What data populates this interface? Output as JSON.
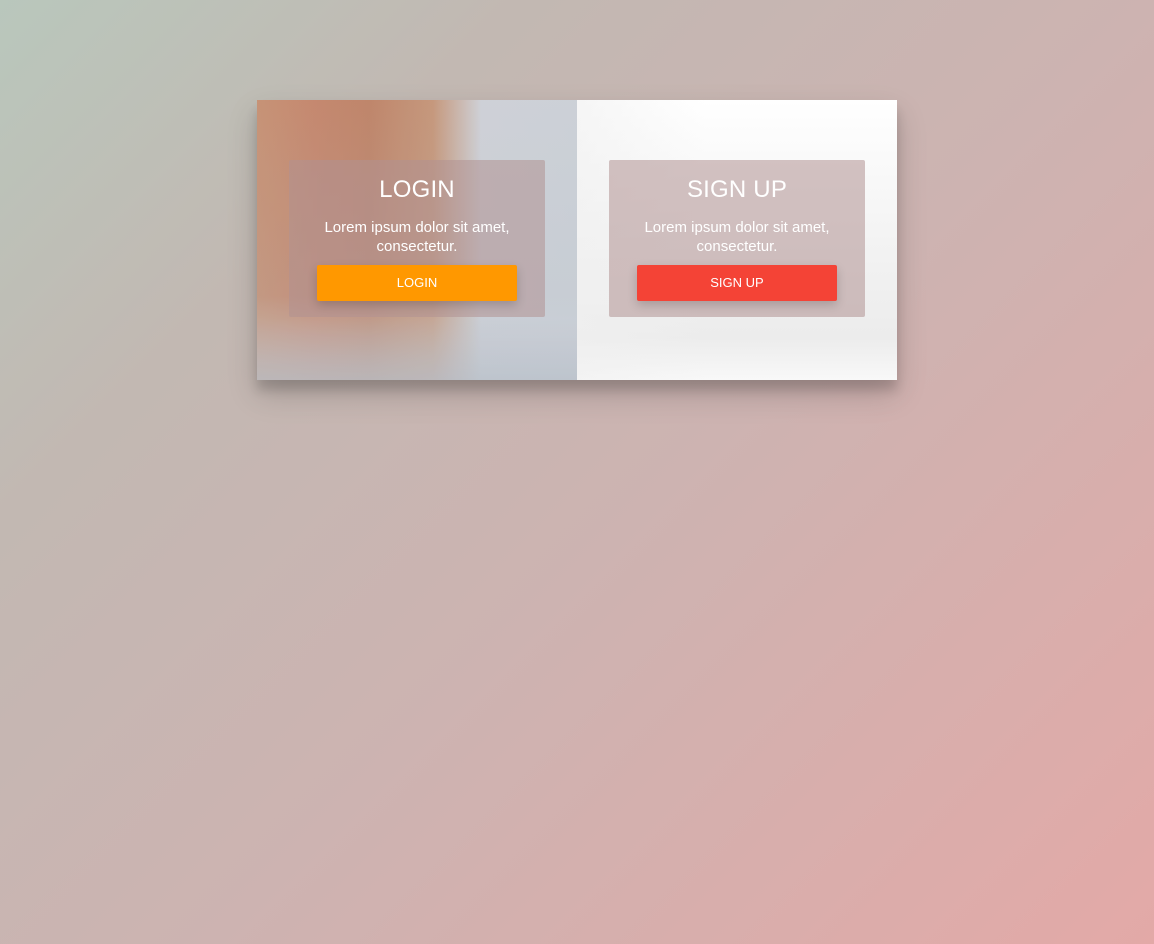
{
  "login": {
    "title": "LOGIN",
    "description": "Lorem ipsum dolor sit amet, consectetur.",
    "button_label": "LOGIN",
    "button_color": "#ff9800"
  },
  "signup": {
    "title": "SIGN UP",
    "description": "Lorem ipsum dolor sit amet, consectetur.",
    "button_label": "SIGN UP",
    "button_color": "#f44336"
  },
  "colors": {
    "box_overlay": "#b09292",
    "text": "#ffffff"
  }
}
